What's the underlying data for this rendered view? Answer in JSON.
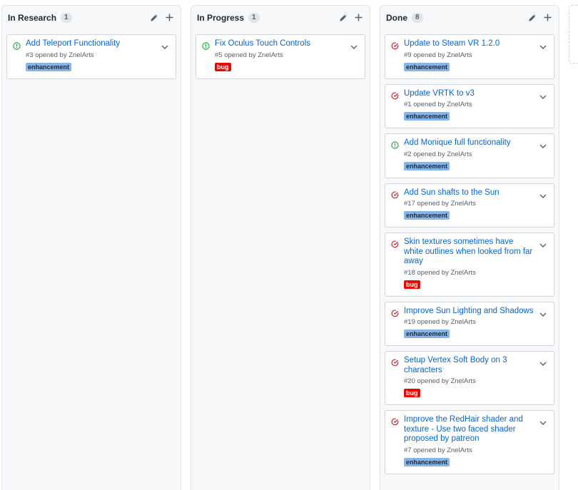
{
  "colors": {
    "enhancement": "#84b6eb",
    "bug": "#ee0701",
    "open_state": "#28a745",
    "closed_state": "#cb2431",
    "link": "#0366d6"
  },
  "columns": [
    {
      "title": "In Research",
      "count": "1",
      "cards": [
        {
          "title": "Add Teleport Functionality",
          "meta": "#3 opened by ZnelArts",
          "label": "enhancement",
          "state": "open-issue-icon"
        }
      ]
    },
    {
      "title": "In Progress",
      "count": "1",
      "cards": [
        {
          "title": "Fix Oculus Touch Controls",
          "meta": "#5 opened by ZnelArts",
          "label": "bug",
          "state": "open-issue-icon"
        }
      ]
    },
    {
      "title": "Done",
      "count": "8",
      "cards": [
        {
          "title": "Update to Steam VR 1.2.0",
          "meta": "#9 opened by ZnelArts",
          "label": "enhancement",
          "state": "closed-issue-icon"
        },
        {
          "title": "Update VRTK to v3",
          "meta": "#1 opened by ZnelArts",
          "label": "enhancement",
          "state": "closed-issue-icon"
        },
        {
          "title": "Add Monique full functionality",
          "meta": "#2 opened by ZnelArts",
          "label": "enhancement",
          "state": "open-issue-icon"
        },
        {
          "title": "Add Sun shafts to the Sun",
          "meta": "#17 opened by ZnelArts",
          "label": "enhancement",
          "state": "closed-issue-icon"
        },
        {
          "title": "Skin textures sometimes have white outlines when looked from far away",
          "meta": "#18 opened by ZnelArts",
          "label": "bug",
          "state": "closed-issue-icon"
        },
        {
          "title": "Improve Sun Lighting and Shadows",
          "meta": "#19 opened by ZnelArts",
          "label": "enhancement",
          "state": "closed-issue-icon"
        },
        {
          "title": "Setup Vertex Soft Body on 3 characters",
          "meta": "#20 opened by ZnelArts",
          "label": "bug",
          "state": "closed-issue-icon"
        },
        {
          "title": "Improve the RedHair shader and texture - Use two faced shader proposed by patreon",
          "meta": "#7 opened by ZnelArts",
          "label": "enhancement",
          "state": "closed-issue-icon"
        }
      ]
    }
  ]
}
